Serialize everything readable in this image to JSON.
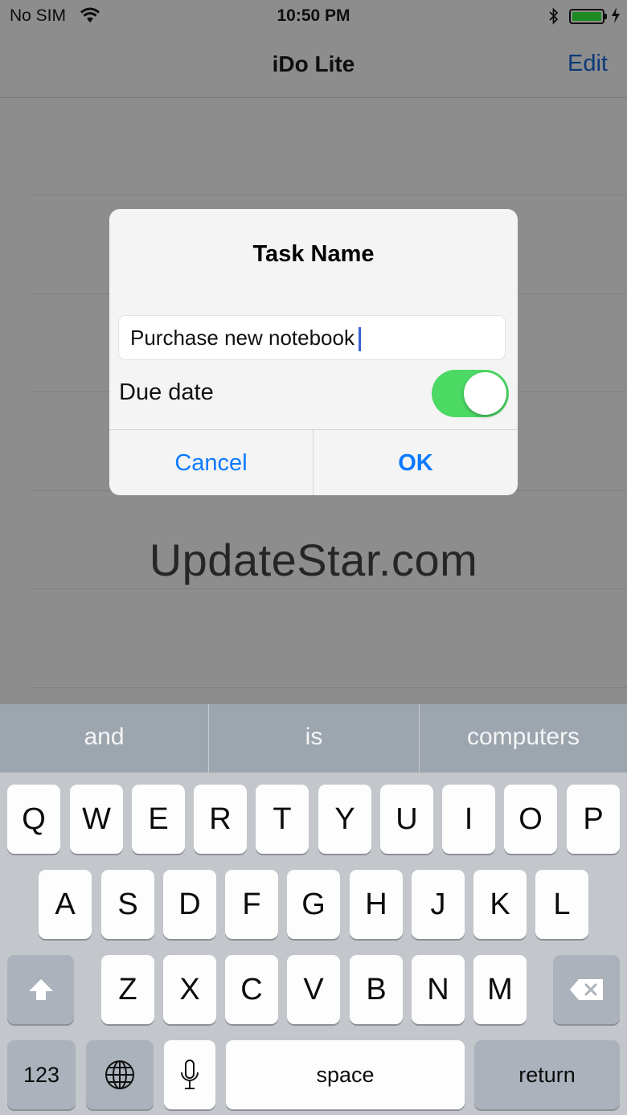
{
  "status": {
    "carrier": "No SIM",
    "time": "10:50 PM",
    "battery_color": "#1d8a23"
  },
  "navbar": {
    "title": "iDo Lite",
    "edit_label": "Edit"
  },
  "watermark": "UpdateStar.com",
  "alert": {
    "title": "Task Name",
    "field_value": "Purchase new notebook",
    "due_label": "Due date",
    "due_toggle_on": true,
    "cancel_label": "Cancel",
    "ok_label": "OK"
  },
  "keyboard": {
    "suggestions": [
      "and",
      "is",
      "computers"
    ],
    "row1": [
      "Q",
      "W",
      "E",
      "R",
      "T",
      "Y",
      "U",
      "I",
      "O",
      "P"
    ],
    "row2": [
      "A",
      "S",
      "D",
      "F",
      "G",
      "H",
      "J",
      "K",
      "L"
    ],
    "row3": [
      "Z",
      "X",
      "C",
      "V",
      "B",
      "N",
      "M"
    ],
    "numbers_label": "123",
    "space_label": "space",
    "return_label": "return"
  },
  "colors": {
    "accent": "#0a7aff",
    "toggle_on": "#4cd964"
  }
}
